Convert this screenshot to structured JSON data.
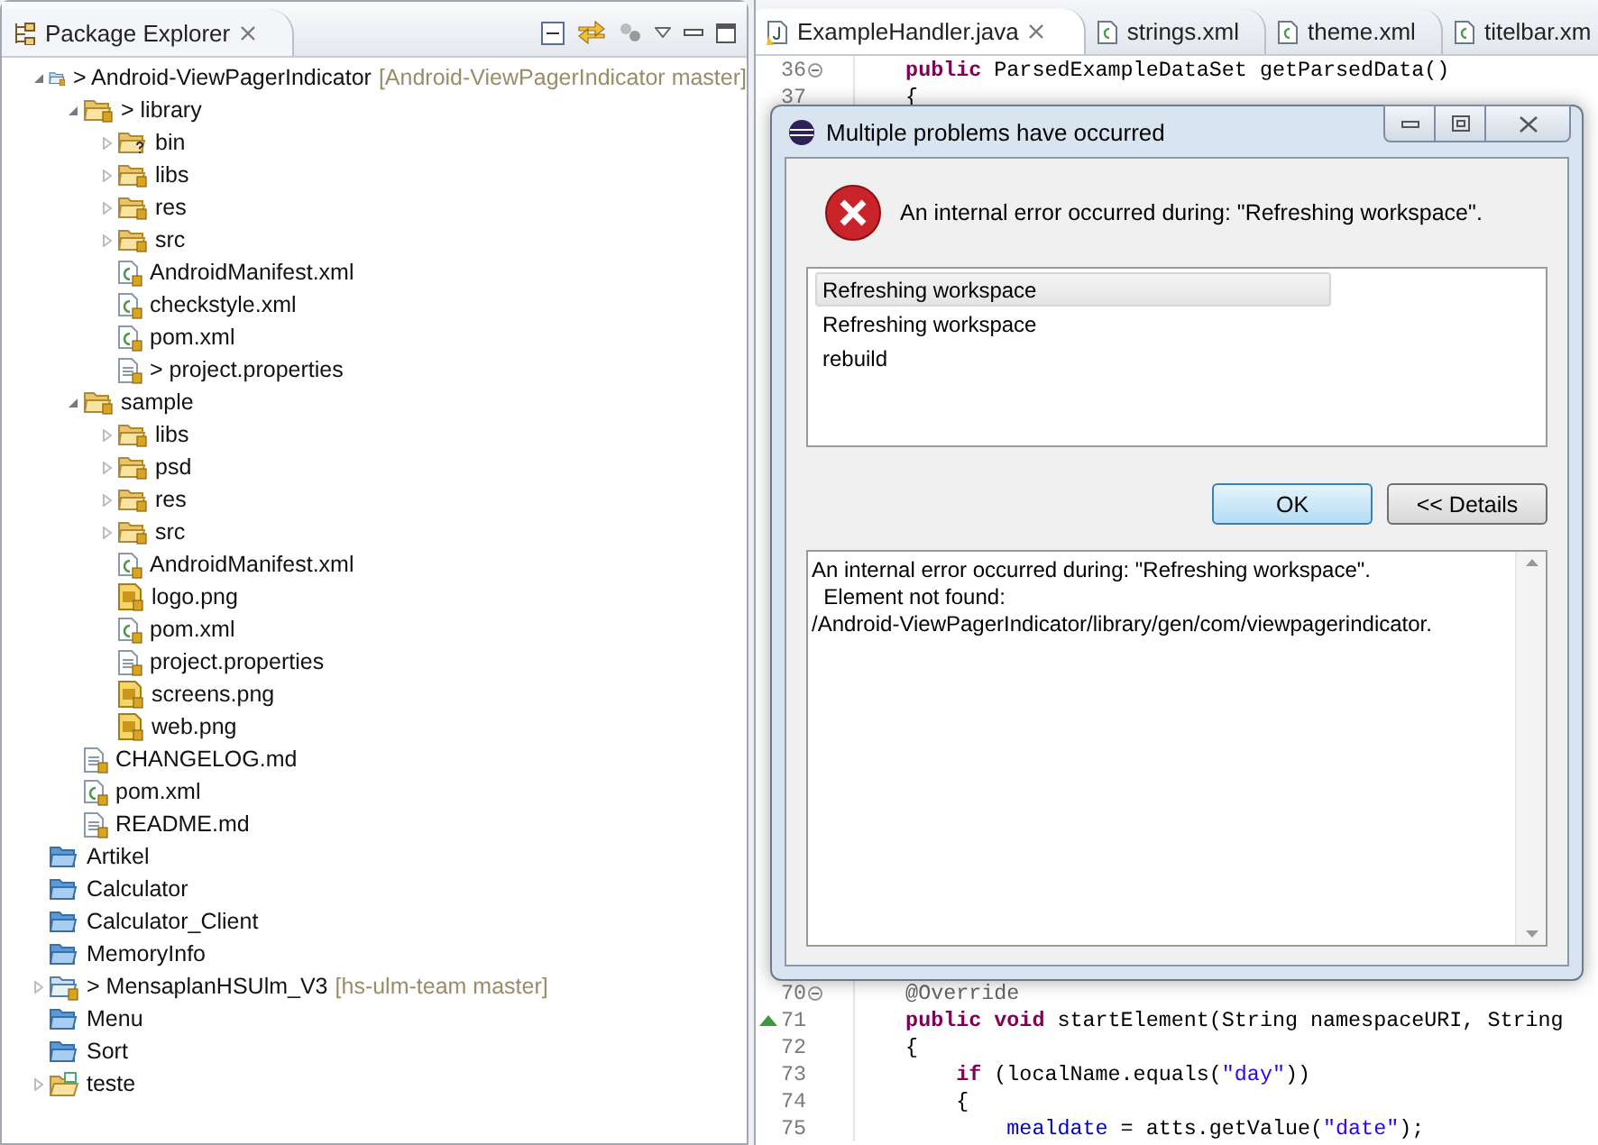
{
  "explorer": {
    "title": "Package Explorer",
    "tree": [
      {
        "label": "Android-ViewPagerIndicator",
        "prefix": ">",
        "repo": "[Android-ViewPagerIndicator master]",
        "kind": "git-project",
        "expanded": true,
        "children": [
          {
            "label": "library",
            "prefix": ">",
            "kind": "package-folder",
            "expanded": true,
            "children": [
              {
                "label": "bin",
                "kind": "unknown-folder",
                "expanded": false
              },
              {
                "label": "libs",
                "kind": "package-folder",
                "expanded": false
              },
              {
                "label": "res",
                "kind": "package-folder",
                "expanded": false
              },
              {
                "label": "src",
                "kind": "package-folder",
                "expanded": false
              },
              {
                "label": "AndroidManifest.xml",
                "kind": "xml-file"
              },
              {
                "label": "checkstyle.xml",
                "kind": "xml-file"
              },
              {
                "label": "pom.xml",
                "kind": "xml-file"
              },
              {
                "label": "project.properties",
                "prefix": ">",
                "kind": "text-file"
              }
            ]
          },
          {
            "label": "sample",
            "kind": "package-folder",
            "expanded": true,
            "children": [
              {
                "label": "libs",
                "kind": "package-folder",
                "expanded": false
              },
              {
                "label": "psd",
                "kind": "package-folder",
                "expanded": false
              },
              {
                "label": "res",
                "kind": "package-folder",
                "expanded": false
              },
              {
                "label": "src",
                "kind": "package-folder",
                "expanded": false
              },
              {
                "label": "AndroidManifest.xml",
                "kind": "xml-file"
              },
              {
                "label": "logo.png",
                "kind": "image-file"
              },
              {
                "label": "pom.xml",
                "kind": "xml-file"
              },
              {
                "label": "project.properties",
                "kind": "text-file"
              },
              {
                "label": "screens.png",
                "kind": "image-file"
              },
              {
                "label": "web.png",
                "kind": "image-file"
              }
            ]
          },
          {
            "label": "CHANGELOG.md",
            "kind": "text-file"
          },
          {
            "label": "pom.xml",
            "kind": "xml-file"
          },
          {
            "label": "README.md",
            "kind": "text-file"
          }
        ]
      },
      {
        "label": "Artikel",
        "kind": "closed-project"
      },
      {
        "label": "Calculator",
        "kind": "closed-project"
      },
      {
        "label": "Calculator_Client",
        "kind": "closed-project"
      },
      {
        "label": "MemoryInfo",
        "kind": "closed-project"
      },
      {
        "label": "MensaplanHSUlm_V3",
        "prefix": ">",
        "repo": "[hs-ulm-team master]",
        "kind": "git-project",
        "expanded": false
      },
      {
        "label": "Menu",
        "kind": "closed-project"
      },
      {
        "label": "Sort",
        "kind": "closed-project"
      },
      {
        "label": "teste",
        "kind": "java-project",
        "expanded": false
      }
    ]
  },
  "editor": {
    "tabs": [
      {
        "label": "ExampleHandler.java",
        "kind": "java",
        "selected": true
      },
      {
        "label": "strings.xml",
        "kind": "xml",
        "selected": false
      },
      {
        "label": "theme.xml",
        "kind": "xml",
        "selected": false
      },
      {
        "label": "titelbar.xm",
        "kind": "xml",
        "selected": false
      }
    ],
    "top_lines": [
      {
        "number": "36",
        "folding": true,
        "marker": false,
        "tokens": [
          {
            "kind": "keyword",
            "text": "    public"
          },
          {
            "kind": "plain",
            "text": " ParsedExampleDataSet getParsedData()"
          }
        ]
      },
      {
        "number": "37",
        "folding": false,
        "marker": false,
        "tokens": [
          {
            "kind": "plain",
            "text": "    {"
          }
        ]
      }
    ],
    "bottom_lines": [
      {
        "number": "70",
        "folding": true,
        "marker": false,
        "tokens": [
          {
            "kind": "annotation",
            "text": "    @Override"
          }
        ]
      },
      {
        "number": "71",
        "folding": false,
        "marker": true,
        "tokens": [
          {
            "kind": "keyword",
            "text": "    public void"
          },
          {
            "kind": "plain",
            "text": " startElement(String namespaceURI, String"
          }
        ]
      },
      {
        "number": "72",
        "folding": false,
        "marker": false,
        "tokens": [
          {
            "kind": "plain",
            "text": "    {"
          }
        ]
      },
      {
        "number": "73",
        "folding": false,
        "marker": false,
        "tokens": [
          {
            "kind": "keyword",
            "text": "        if"
          },
          {
            "kind": "plain",
            "text": " (localName.equals("
          },
          {
            "kind": "string",
            "text": "\"day\""
          },
          {
            "kind": "plain",
            "text": "))"
          }
        ]
      },
      {
        "number": "74",
        "folding": false,
        "marker": false,
        "tokens": [
          {
            "kind": "plain",
            "text": "        {"
          }
        ]
      },
      {
        "number": "75",
        "folding": false,
        "marker": false,
        "tokens": [
          {
            "kind": "field",
            "text": "            mealdate"
          },
          {
            "kind": "plain",
            "text": " = atts.getValue("
          },
          {
            "kind": "string",
            "text": "\"date\""
          },
          {
            "kind": "plain",
            "text": ");"
          }
        ]
      }
    ]
  },
  "dialog": {
    "title": "Multiple problems have occurred",
    "message": "An internal error occurred during: \"Refreshing workspace\".",
    "problems": [
      {
        "label": "Refreshing workspace",
        "selected": true
      },
      {
        "label": "Refreshing workspace",
        "selected": false
      },
      {
        "label": "rebuild",
        "selected": false
      }
    ],
    "buttons": [
      {
        "label": "OK",
        "default": true
      },
      {
        "label": "<< Details",
        "default": false
      }
    ],
    "details": [
      "An internal error occurred during: \"Refreshing workspace\".",
      "  Element not found:",
      "/Android-ViewPagerIndicator/library/gen/com/viewpagerindicator."
    ]
  }
}
